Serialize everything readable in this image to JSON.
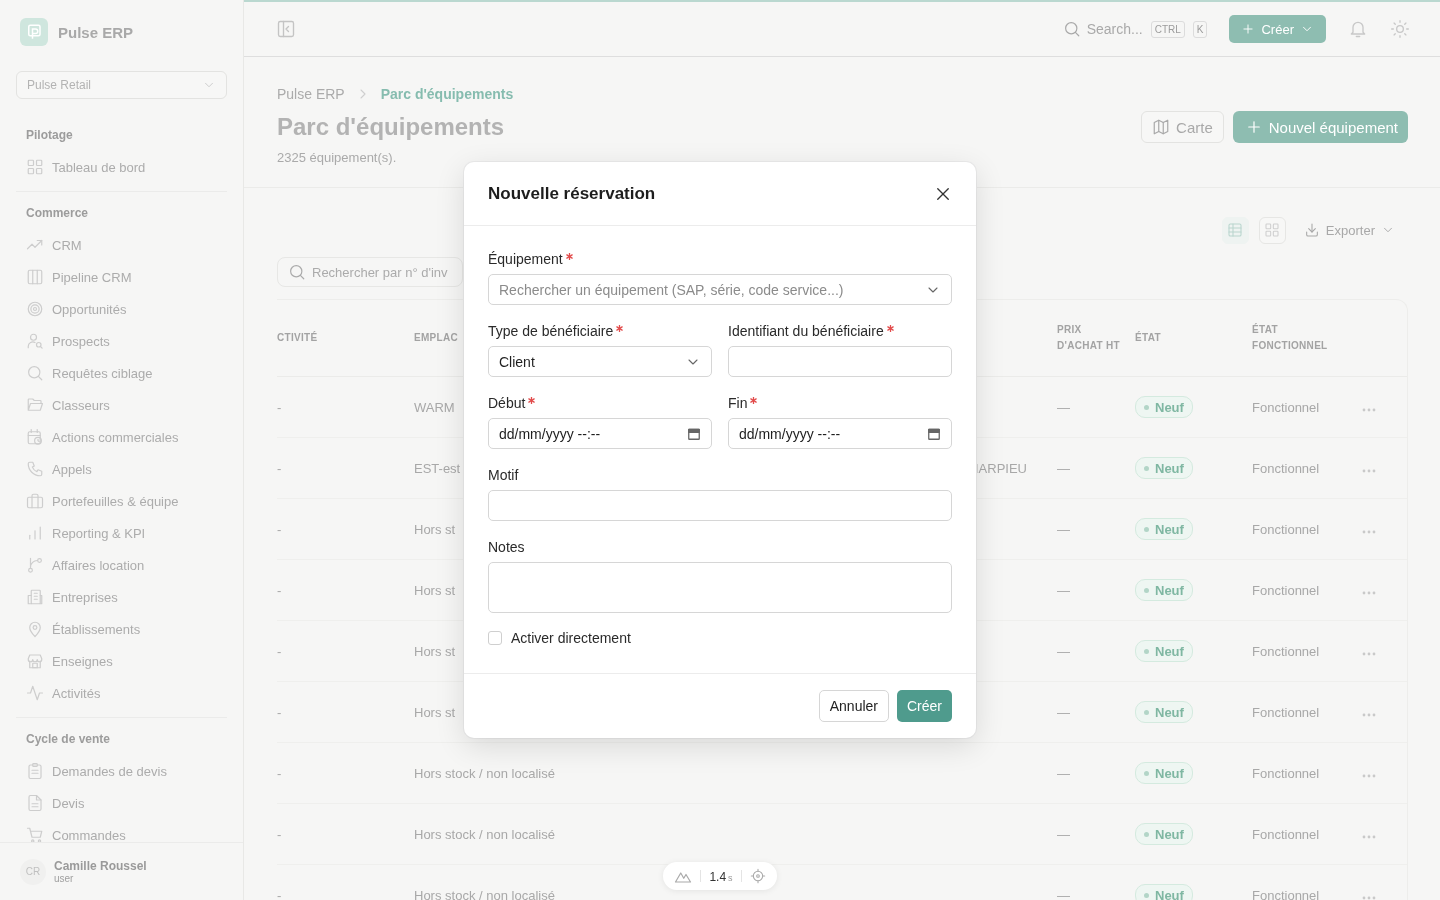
{
  "sidebar": {
    "brand": "Pulse ERP",
    "workspace": "Pulse Retail",
    "groups": [
      {
        "title": "Pilotage",
        "items": [
          "Tableau de bord"
        ]
      },
      {
        "title": "Commerce",
        "items": [
          "CRM",
          "Pipeline CRM",
          "Opportunités",
          "Prospects",
          "Requêtes ciblage",
          "Classeurs",
          "Actions commerciales",
          "Appels",
          "Portefeuilles & équipe",
          "Reporting & KPI",
          "Affaires location",
          "Entreprises",
          "Établissements",
          "Enseignes",
          "Activités"
        ]
      },
      {
        "title": "Cycle de vente",
        "items": [
          "Demandes de devis",
          "Devis",
          "Commandes"
        ]
      }
    ],
    "user": {
      "initials": "CR",
      "name": "Camille Roussel",
      "role": "user"
    }
  },
  "topbar": {
    "search_placeholder": "Search...",
    "shortcut": [
      "CTRL",
      "K"
    ],
    "create_button": "Créer"
  },
  "breadcrumb": [
    {
      "label": "Pulse ERP",
      "current": false
    },
    {
      "label": "Parc d'équipements",
      "current": true
    }
  ],
  "page": {
    "title": "Parc d'équipements",
    "subtitle": "2325 équipement(s).",
    "actions": [
      {
        "kind": "secondary",
        "label": "Carte"
      },
      {
        "kind": "primary",
        "label": "Nouvel équipement"
      }
    ]
  },
  "view_toggle": [
    {
      "kind": "table",
      "selected": true
    },
    {
      "kind": "grid",
      "selected": false
    }
  ],
  "export_button": "Exporter",
  "table_search": {
    "placeholder": "Rechercher par n° d'inv"
  },
  "table": {
    "columns": [
      "CTIVITÉ",
      "EMPLAC",
      "PRIX D'ACHAT HT",
      "ÉTAT",
      "ÉTAT FONCTIONNEL"
    ],
    "rows": [
      {
        "activite": "-",
        "emplacement": "WARM",
        "prix": "—",
        "etat": "Neuf",
        "etat_fonctionnel": "Fonctionnel"
      },
      {
        "activite": "-",
        "emplacement": "EST-est",
        "column_3": "IARPIEU",
        "prix": "—",
        "etat": "Neuf",
        "etat_fonctionnel": "Fonctionnel"
      },
      {
        "activite": "-",
        "emplacement": "Hors st",
        "prix": "—",
        "etat": "Neuf",
        "etat_fonctionnel": "Fonctionnel"
      },
      {
        "activite": "-",
        "emplacement": "Hors st",
        "prix": "—",
        "etat": "Neuf",
        "etat_fonctionnel": "Fonctionnel"
      },
      {
        "activite": "-",
        "emplacement": "Hors st",
        "prix": "—",
        "etat": "Neuf",
        "etat_fonctionnel": "Fonctionnel"
      },
      {
        "activite": "-",
        "emplacement": "Hors st",
        "prix": "—",
        "etat": "Neuf",
        "etat_fonctionnel": "Fonctionnel"
      },
      {
        "activite": "-",
        "emplacement": "Hors stock / non localisé",
        "prix": "—",
        "etat": "Neuf",
        "etat_fonctionnel": "Fonctionnel"
      },
      {
        "activite": "-",
        "emplacement": "Hors stock / non localisé",
        "prix": "—",
        "etat": "Neuf",
        "etat_fonctionnel": "Fonctionnel"
      },
      {
        "activite": "-",
        "emplacement": "Hors stock / non localisé",
        "prix": "—",
        "etat": "Neuf",
        "etat_fonctionnel": "Fonctionnel"
      }
    ]
  },
  "dialog": {
    "title": "Nouvelle réservation",
    "rows": [
      [
        {
          "kind": "combobox",
          "label": "Équipement",
          "required": true,
          "placeholder": "Rechercher un équipement (SAP, série, code service...)"
        }
      ],
      [
        {
          "kind": "select",
          "label": "Type de bénéficiaire",
          "required": true,
          "value": "Client"
        },
        {
          "kind": "text",
          "label": "Identifiant du bénéficiaire",
          "required": true
        }
      ],
      [
        {
          "kind": "datetime",
          "label": "Début",
          "required": true,
          "value": "dd/mm/yyyy --:--"
        },
        {
          "kind": "datetime",
          "label": "Fin",
          "required": true,
          "value": "dd/mm/yyyy --:--"
        }
      ],
      [
        {
          "kind": "text",
          "label": "Motif",
          "required": false
        }
      ],
      [
        {
          "kind": "textarea",
          "label": "Notes",
          "required": false
        }
      ]
    ],
    "checkbox": {
      "label": "Activer directement",
      "checked": false
    },
    "buttons": [
      {
        "kind": "secondary",
        "label": "Annuler"
      },
      {
        "kind": "primary",
        "label": "Créer"
      }
    ]
  },
  "dev_indicator": {
    "value": "1.4",
    "unit": "s"
  }
}
